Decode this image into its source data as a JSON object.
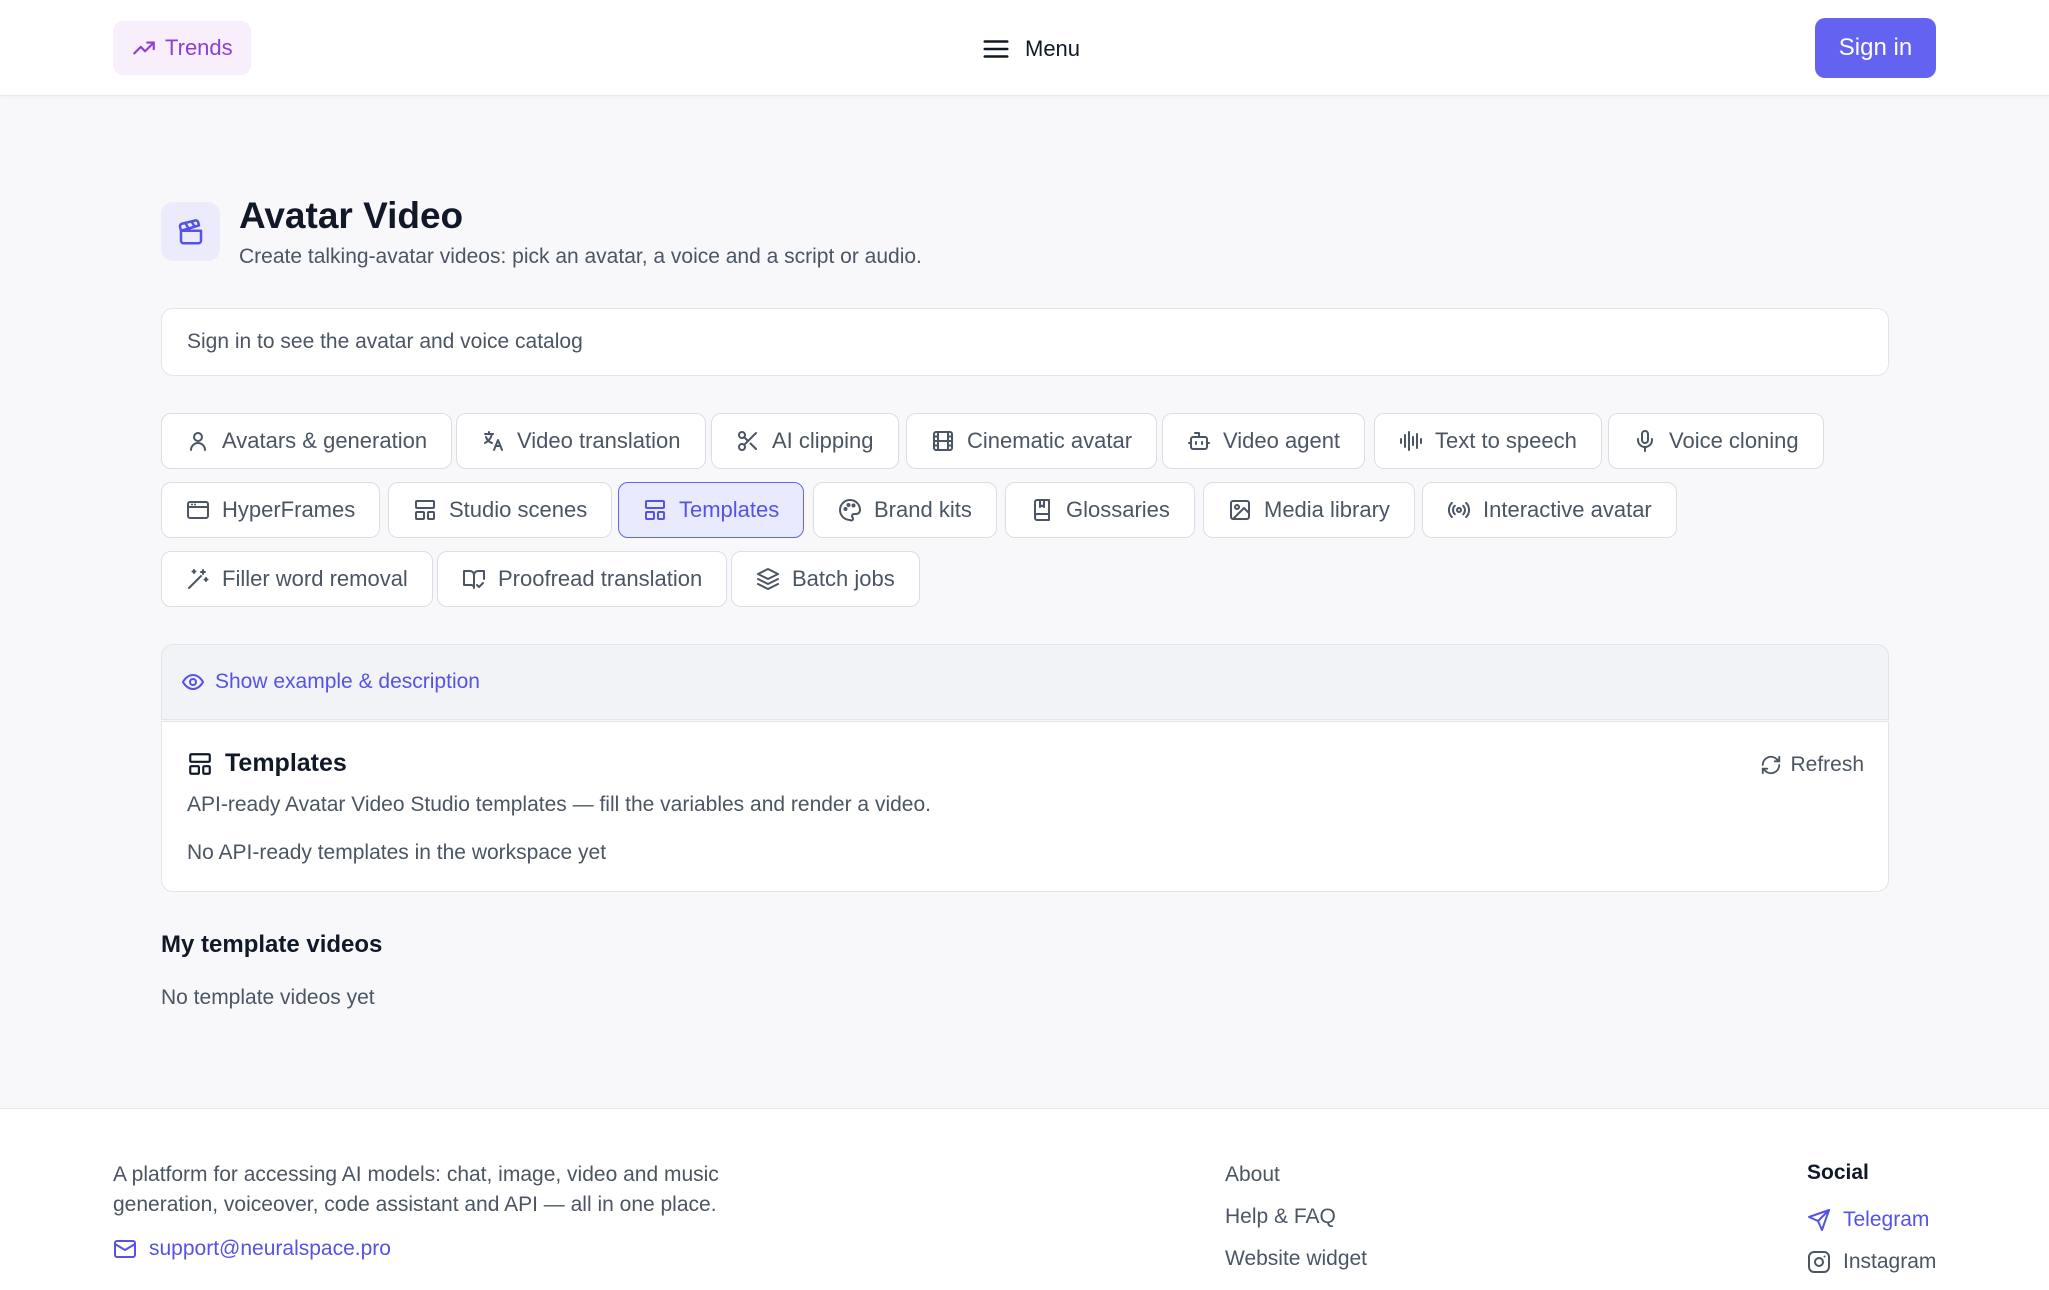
{
  "header": {
    "trends_label": "Trends",
    "menu_label": "Menu",
    "signin_label": "Sign in"
  },
  "page": {
    "title": "Avatar Video",
    "subtitle": "Create talking-avatar videos: pick an avatar, a voice and a script or audio.",
    "catalog_notice": "Sign in to see the avatar and voice catalog"
  },
  "tabs": [
    {
      "label": "Avatars & generation",
      "icon": "user-icon"
    },
    {
      "label": "Video translation",
      "icon": "translate-icon"
    },
    {
      "label": "AI clipping",
      "icon": "scissors-icon"
    },
    {
      "label": "Cinematic avatar",
      "icon": "film-icon"
    },
    {
      "label": "Video agent",
      "icon": "robot-icon"
    },
    {
      "label": "Text to speech",
      "icon": "audio-wave-icon"
    },
    {
      "label": "Voice cloning",
      "icon": "microphone-icon"
    },
    {
      "label": "HyperFrames",
      "icon": "browser-window-icon"
    },
    {
      "label": "Studio scenes",
      "icon": "layout-icon"
    },
    {
      "label": "Templates",
      "icon": "layout-icon",
      "active": true
    },
    {
      "label": "Brand kits",
      "icon": "palette-icon"
    },
    {
      "label": "Glossaries",
      "icon": "book-icon"
    },
    {
      "label": "Media library",
      "icon": "image-icon"
    },
    {
      "label": "Interactive avatar",
      "icon": "broadcast-icon"
    },
    {
      "label": "Filler word removal",
      "icon": "magic-wand-icon"
    },
    {
      "label": "Proofread translation",
      "icon": "book-check-icon"
    },
    {
      "label": "Batch jobs",
      "icon": "layers-icon"
    }
  ],
  "example": {
    "label": "Show example & description"
  },
  "templates": {
    "title": "Templates",
    "refresh_label": "Refresh",
    "description": "API-ready Avatar Video Studio templates — fill the variables and render a video.",
    "empty": "No API-ready templates in the workspace yet"
  },
  "my_videos": {
    "title": "My template videos",
    "empty": "No template videos yet"
  },
  "footer": {
    "description": "A platform for accessing AI models: chat, image, video and music generation, voiceover, code assistant and API — all in one place.",
    "email": "support@neuralspace.pro",
    "links": [
      "About",
      "Help & FAQ",
      "Website widget"
    ],
    "social_title": "Social",
    "social": [
      {
        "label": "Telegram",
        "icon": "telegram-icon"
      },
      {
        "label": "Instagram",
        "icon": "instagram-icon"
      }
    ]
  },
  "colors": {
    "accent": "#6463f1",
    "accent_text": "#5553e6",
    "trends": "#8b3fd6",
    "muted_text": "#4b5563"
  }
}
